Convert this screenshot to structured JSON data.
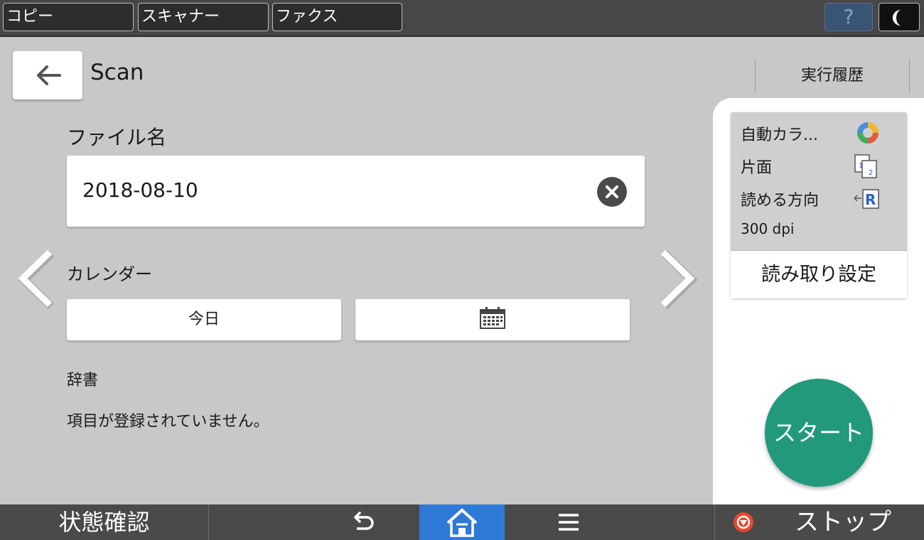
{
  "topbar": {
    "tabs": [
      "コピー",
      "スキャナー",
      "ファクス"
    ],
    "help_label": "?"
  },
  "header": {
    "title": "Scan",
    "history_label": "実行履歴"
  },
  "main": {
    "file_name_label": "ファイル名",
    "file_name_value": "2018-08-10",
    "calendar_label": "カレンダー",
    "today_button": "今日",
    "dictionary_label": "辞書",
    "no_items_text": "項目が登録されていません。"
  },
  "settings": {
    "color_mode": "自動カラ...",
    "sides": "片面",
    "orientation": "読める方向",
    "resolution": "300 dpi",
    "read_settings_button": "読み取り設定"
  },
  "start_button": "スタート",
  "bottombar": {
    "status_check": "状態確認",
    "stop_label": "ストップ"
  },
  "colors": {
    "start_green": "#21997a",
    "home_blue": "#2e79d6",
    "stop_red": "#e8472f"
  }
}
